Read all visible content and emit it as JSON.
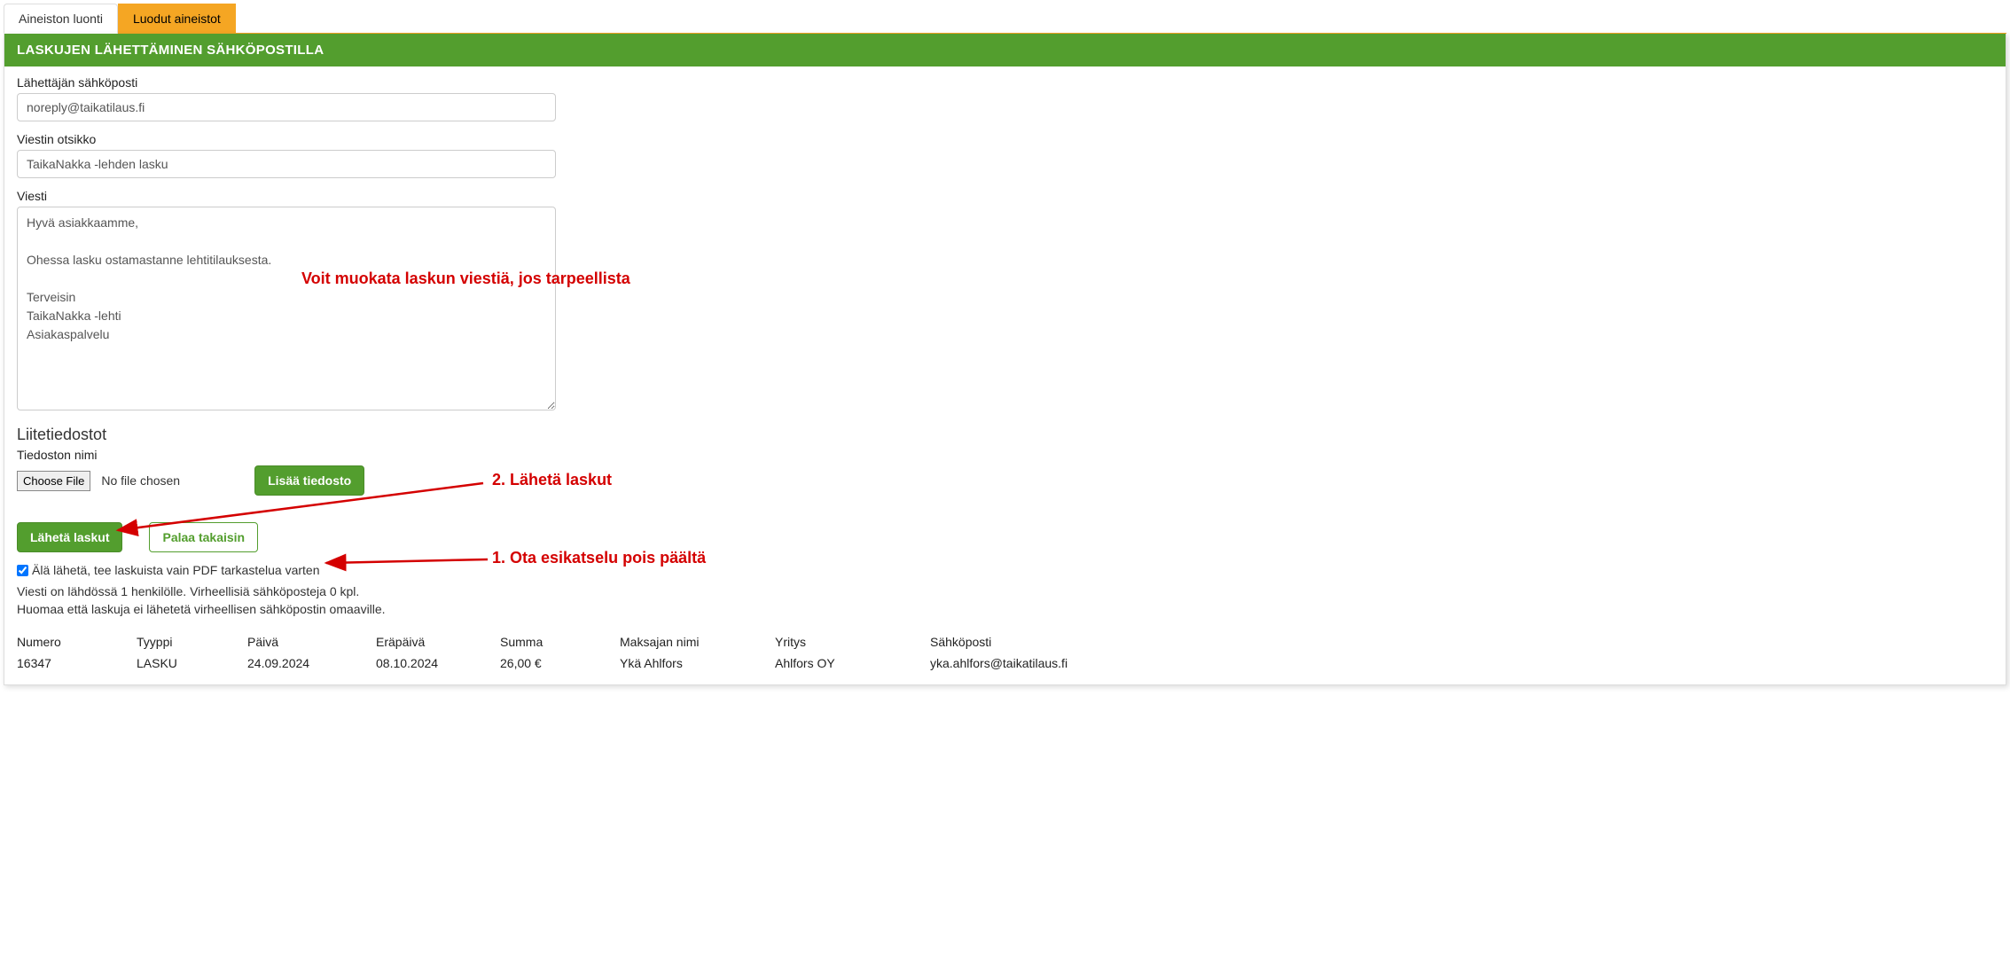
{
  "tabs": {
    "create": "Aineiston luonti",
    "created": "Luodut aineistot"
  },
  "panel": {
    "title": "LASKUJEN LÄHETTÄMINEN SÄHKÖPOSTILLA"
  },
  "form": {
    "sender_label": "Lähettäjän sähköposti",
    "sender_value": "noreply@taikatilaus.fi",
    "subject_label": "Viestin otsikko",
    "subject_value": "TaikaNakka -lehden lasku",
    "message_label": "Viesti",
    "message_value": "Hyvä asiakkaamme,\n\nOhessa lasku ostamastanne lehtitilauksesta.\n\nTerveisin\nTaikaNakka -lehti\nAsiakaspalvelu",
    "attachments_heading": "Liitetiedostot",
    "filename_label": "Tiedoston nimi",
    "choose_file": "Choose File",
    "no_file": "No file chosen",
    "add_file": "Lisää tiedosto",
    "send_button": "Lähetä laskut",
    "back_button": "Palaa takaisin",
    "preview_checkbox_label": "Älä lähetä, tee laskuista vain PDF tarkastelua varten",
    "info_line1": "Viesti on lähdössä 1 henkilölle. Virheellisiä sähköposteja 0 kpl.",
    "info_line2": "Huomaa että laskuja ei lähetetä virheellisen sähköpostin omaaville."
  },
  "table": {
    "headers": {
      "numero": "Numero",
      "tyyppi": "Tyyppi",
      "paiva": "Päivä",
      "erapaiva": "Eräpäivä",
      "summa": "Summa",
      "maksaja": "Maksajan nimi",
      "yritys": "Yritys",
      "sahkoposti": "Sähköposti"
    },
    "rows": [
      {
        "numero": "16347",
        "tyyppi": "LASKU",
        "paiva": "24.09.2024",
        "erapaiva": "08.10.2024",
        "summa": "26,00 €",
        "maksaja": "Ykä Ahlfors",
        "yritys": "Ahlfors OY",
        "sahkoposti": "yka.ahlfors@taikatilaus.fi"
      }
    ]
  },
  "annotations": {
    "edit_message": "Voit muokata laskun viestiä, jos tarpeellista",
    "step2": "2. Lähetä laskut",
    "step1": "1. Ota esikatselu pois päältä"
  }
}
